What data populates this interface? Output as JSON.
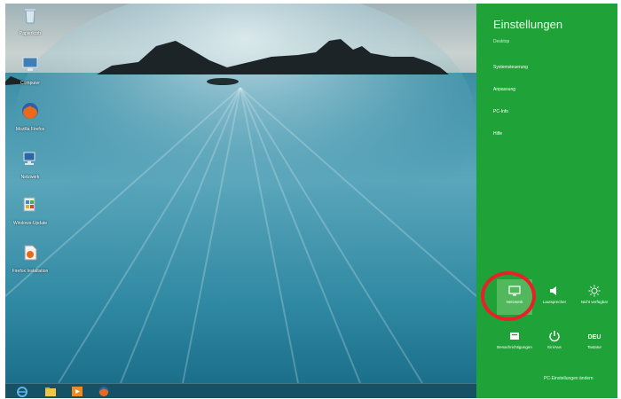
{
  "desktop": {
    "icons": [
      {
        "label": "Papierkorb",
        "icon": "recycle-bin-icon"
      },
      {
        "label": "Computer",
        "icon": "computer-icon"
      },
      {
        "label": "Mozilla Firefox",
        "icon": "firefox-icon"
      },
      {
        "label": "Netzwerk",
        "icon": "network-icon"
      },
      {
        "label": "Windows-Update",
        "icon": "windows-update-icon"
      },
      {
        "label": "Firefox Installation",
        "icon": "installer-icon"
      }
    ]
  },
  "taskbar": {
    "items": [
      "internet-explorer-icon",
      "file-explorer-icon",
      "media-player-icon",
      "firefox-icon"
    ]
  },
  "charm": {
    "title": "Einstellungen",
    "subtitle": "Desktop",
    "menu": [
      "Systemsteuerung",
      "Anpassung",
      "PC-Info",
      "Hilfe"
    ],
    "tiles": [
      {
        "label": "Netzwerk",
        "icon": "network-monitor-icon",
        "selected": true
      },
      {
        "label": "Lautsprecher",
        "icon": "speaker-icon",
        "selected": false
      },
      {
        "label": "Nicht verfügbar",
        "icon": "brightness-icon",
        "selected": false
      },
      {
        "label": "Benachrichtigungen",
        "icon": "notifications-icon",
        "selected": false
      },
      {
        "label": "Ein/Aus",
        "icon": "power-icon",
        "selected": false
      },
      {
        "label": "Tastatur",
        "icon": "keyboard-icon",
        "selected": false
      }
    ],
    "footer_link": "PC-Einstellungen ändern",
    "colors": {
      "background": "#1fa238",
      "highlight": "#e8202a"
    }
  }
}
